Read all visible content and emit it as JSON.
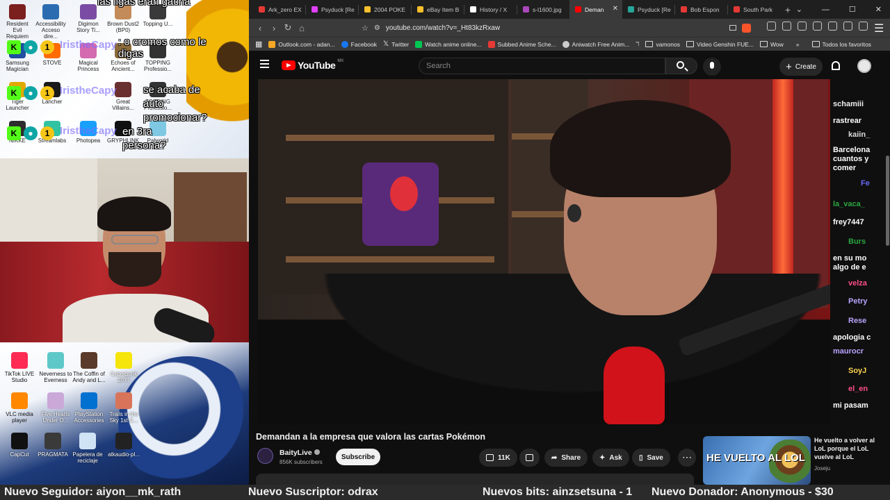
{
  "overlay": {
    "chat": [
      {
        "user": "IristheCapy",
        "msg": "las ligas eran gacha"
      },
      {
        "user": "IristheCapy",
        "msg": ": o cromos como le digas"
      },
      {
        "user": "IristheCapy",
        "msg": "se acaba de auto promocionar?"
      },
      {
        "user": "IristheCapy",
        "msg": "en 3ra persona?"
      }
    ],
    "desktop_icons_top": [
      {
        "label": "Resident Evil Requiem"
      },
      {
        "label": "Accessibility Acceso dire..."
      },
      {
        "label": "Digimon Story Ti..."
      },
      {
        "label": "Brown Dust2 (BP0)"
      },
      {
        "label": "Topping U..."
      },
      {
        "label": "Samsung Magician"
      },
      {
        "label": "STOVE"
      },
      {
        "label": "Magical Princess"
      },
      {
        "label": "Echoes of Ancient..."
      },
      {
        "label": "TOPPING Professio..."
      },
      {
        "label": "Tiger Launcher"
      },
      {
        "label": "Lancher"
      },
      {
        "label": "Great Villains..."
      },
      {
        "label": "TOPPING Professio..."
      },
      {
        "label": "NIKKE"
      },
      {
        "label": "Streamlabs"
      },
      {
        "label": "Photopea"
      },
      {
        "label": "GRYPHLINK"
      },
      {
        "label": "Palworld"
      }
    ],
    "desktop_icons_bottom": [
      {
        "label": "TikTok LIVE Studio"
      },
      {
        "label": "Neverness to Everness"
      },
      {
        "label": "The Coffin of Andy and L..."
      },
      {
        "label": "Cyberpunk 2077"
      },
      {
        "label": "VLC media player"
      },
      {
        "label": "Five Hearts Under O..."
      },
      {
        "label": "PlayStation Accessories"
      },
      {
        "label": "Trails in the Sky 1st C..."
      },
      {
        "label": "CapCut"
      },
      {
        "label": "PRAGMATA"
      },
      {
        "label": "Papelera de reciclaje"
      },
      {
        "label": "atkaudio-pl..."
      }
    ]
  },
  "ticker": [
    {
      "text": "Nuevo Seguidor: aiyon__mk_rath"
    },
    {
      "text": "Nuevo Suscriptor: odrax"
    },
    {
      "text": "Nuevos bits: ainzsetsuna - 1"
    },
    {
      "text": "Nuevo Donador: Anonymous - $30"
    }
  ],
  "browser": {
    "tabs": [
      {
        "title": "Ark_zero EX",
        "color": "#e53935",
        "active": false
      },
      {
        "title": "Psyduck [Re",
        "color": "#e040fb",
        "active": false
      },
      {
        "title": "2004 POKE",
        "color": "#fbc02d",
        "active": false
      },
      {
        "title": "eBay Item B",
        "color": "#fbc02d",
        "active": false
      },
      {
        "title": "History / X",
        "color": "#ffffff",
        "active": false
      },
      {
        "title": "s-l1600.jpg",
        "color": "#ab47bc",
        "active": false
      },
      {
        "title": "Deman",
        "color": "#ff0000",
        "active": true
      },
      {
        "title": "Psyduck [Re",
        "color": "#26a69a",
        "active": false
      },
      {
        "title": "Bob Espon",
        "color": "#e53935",
        "active": false
      },
      {
        "title": "South Park",
        "color": "#e53935",
        "active": false
      }
    ],
    "url": "youtube.com/watch?v=_Ht83kzRxaw",
    "bookmarks": [
      {
        "label": "Outlook.com - adan...",
        "color": "#f9a825"
      },
      {
        "label": "Facebook",
        "color": "#1877f2"
      },
      {
        "label": "Twitter",
        "color": "#ffffff"
      },
      {
        "label": "Watch anime online...",
        "color": "#00c853"
      },
      {
        "label": "Subbed Anime Sche...",
        "color": "#e53935"
      },
      {
        "label": "Aniwatch Free Anim...",
        "color": "#cccccc"
      },
      {
        "label": "vamonos",
        "color": ""
      },
      {
        "label": "Video Genshin FUE...",
        "color": ""
      },
      {
        "label": "Wow",
        "color": ""
      }
    ],
    "bookmarks_right": "Todos los favoritos"
  },
  "youtube": {
    "logo": "YouTube",
    "region": "MX",
    "search_placeholder": "Search",
    "create_label": "Create",
    "video_title": "Demandan a la empresa que valora las cartas Pokémon",
    "channel_name": "BaityLive",
    "channel_subs": "856K subscribers",
    "subscribe_label": "Subscribe",
    "like_count": "11K",
    "share_label": "Share",
    "ask_label": "Ask",
    "save_label": "Save",
    "live_chat": [
      {
        "user": "schamiii",
        "msg": "rastrear"
      },
      {
        "user": "kaiin_",
        "msg": "Barcelona cuantos y comer"
      },
      {
        "user": "Fe",
        "msg": ""
      },
      {
        "user": "la_vaca_",
        "msg": ""
      },
      {
        "user": "frey7447",
        "msg": ""
      },
      {
        "user": "Burs",
        "msg": "en su mo algo de e"
      },
      {
        "user": "velza",
        "msg": ""
      },
      {
        "user": "Petry",
        "msg": ""
      },
      {
        "user": "Rese",
        "msg": "apologia c"
      },
      {
        "user": "maurocr",
        "msg": ""
      },
      {
        "user": "SoyJ",
        "msg": ""
      },
      {
        "user": "el_en",
        "msg": "mi pasam"
      }
    ],
    "recommended": {
      "thumb_text": "HE VUELTO AL LOL",
      "title": "He vuelto a volver al LoL porque el LoL vuelve al LoL",
      "channel": "Joseju"
    }
  }
}
